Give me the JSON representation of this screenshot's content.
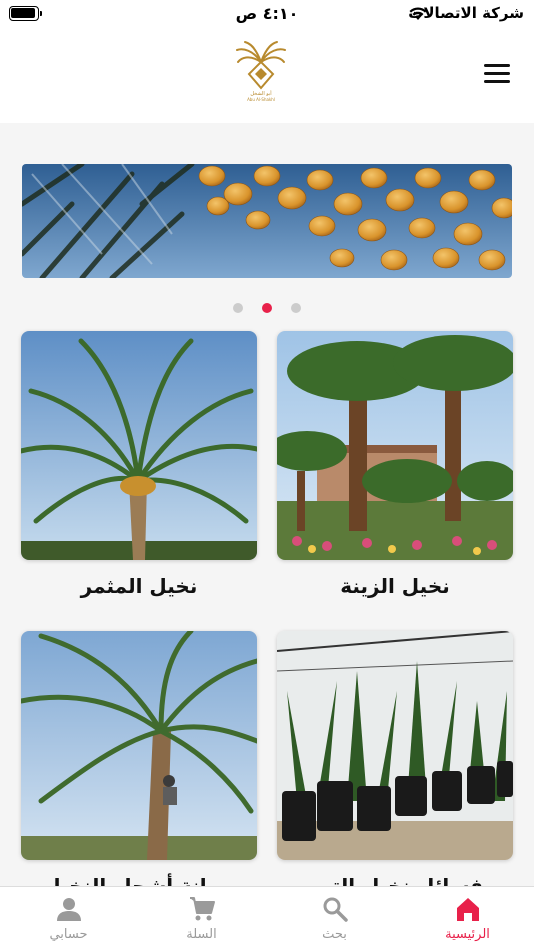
{
  "status_bar": {
    "time": "٤:١٠ ص",
    "carrier": "شركة الاتصالات"
  },
  "header": {
    "logo_text": "أبو الشخل",
    "logo_sub": "Abu Al-Shakhl"
  },
  "banner": {
    "dots": 3,
    "active_dot": 2
  },
  "categories": [
    {
      "label": "نخيل الزينة"
    },
    {
      "label": "نخيل المثمر"
    },
    {
      "label": "فسائل نخيل التمر"
    },
    {
      "label": "صيانة أشجار النخيل"
    }
  ],
  "tabs": [
    {
      "label": "الرئيسية",
      "icon": "home-icon",
      "active": true
    },
    {
      "label": "بحث",
      "icon": "search-icon",
      "active": false
    },
    {
      "label": "السلة",
      "icon": "cart-icon",
      "active": false
    },
    {
      "label": "حسابي",
      "icon": "person-icon",
      "active": false
    }
  ],
  "colors": {
    "accent": "#e8214a",
    "inactive": "#9a9a9a"
  }
}
